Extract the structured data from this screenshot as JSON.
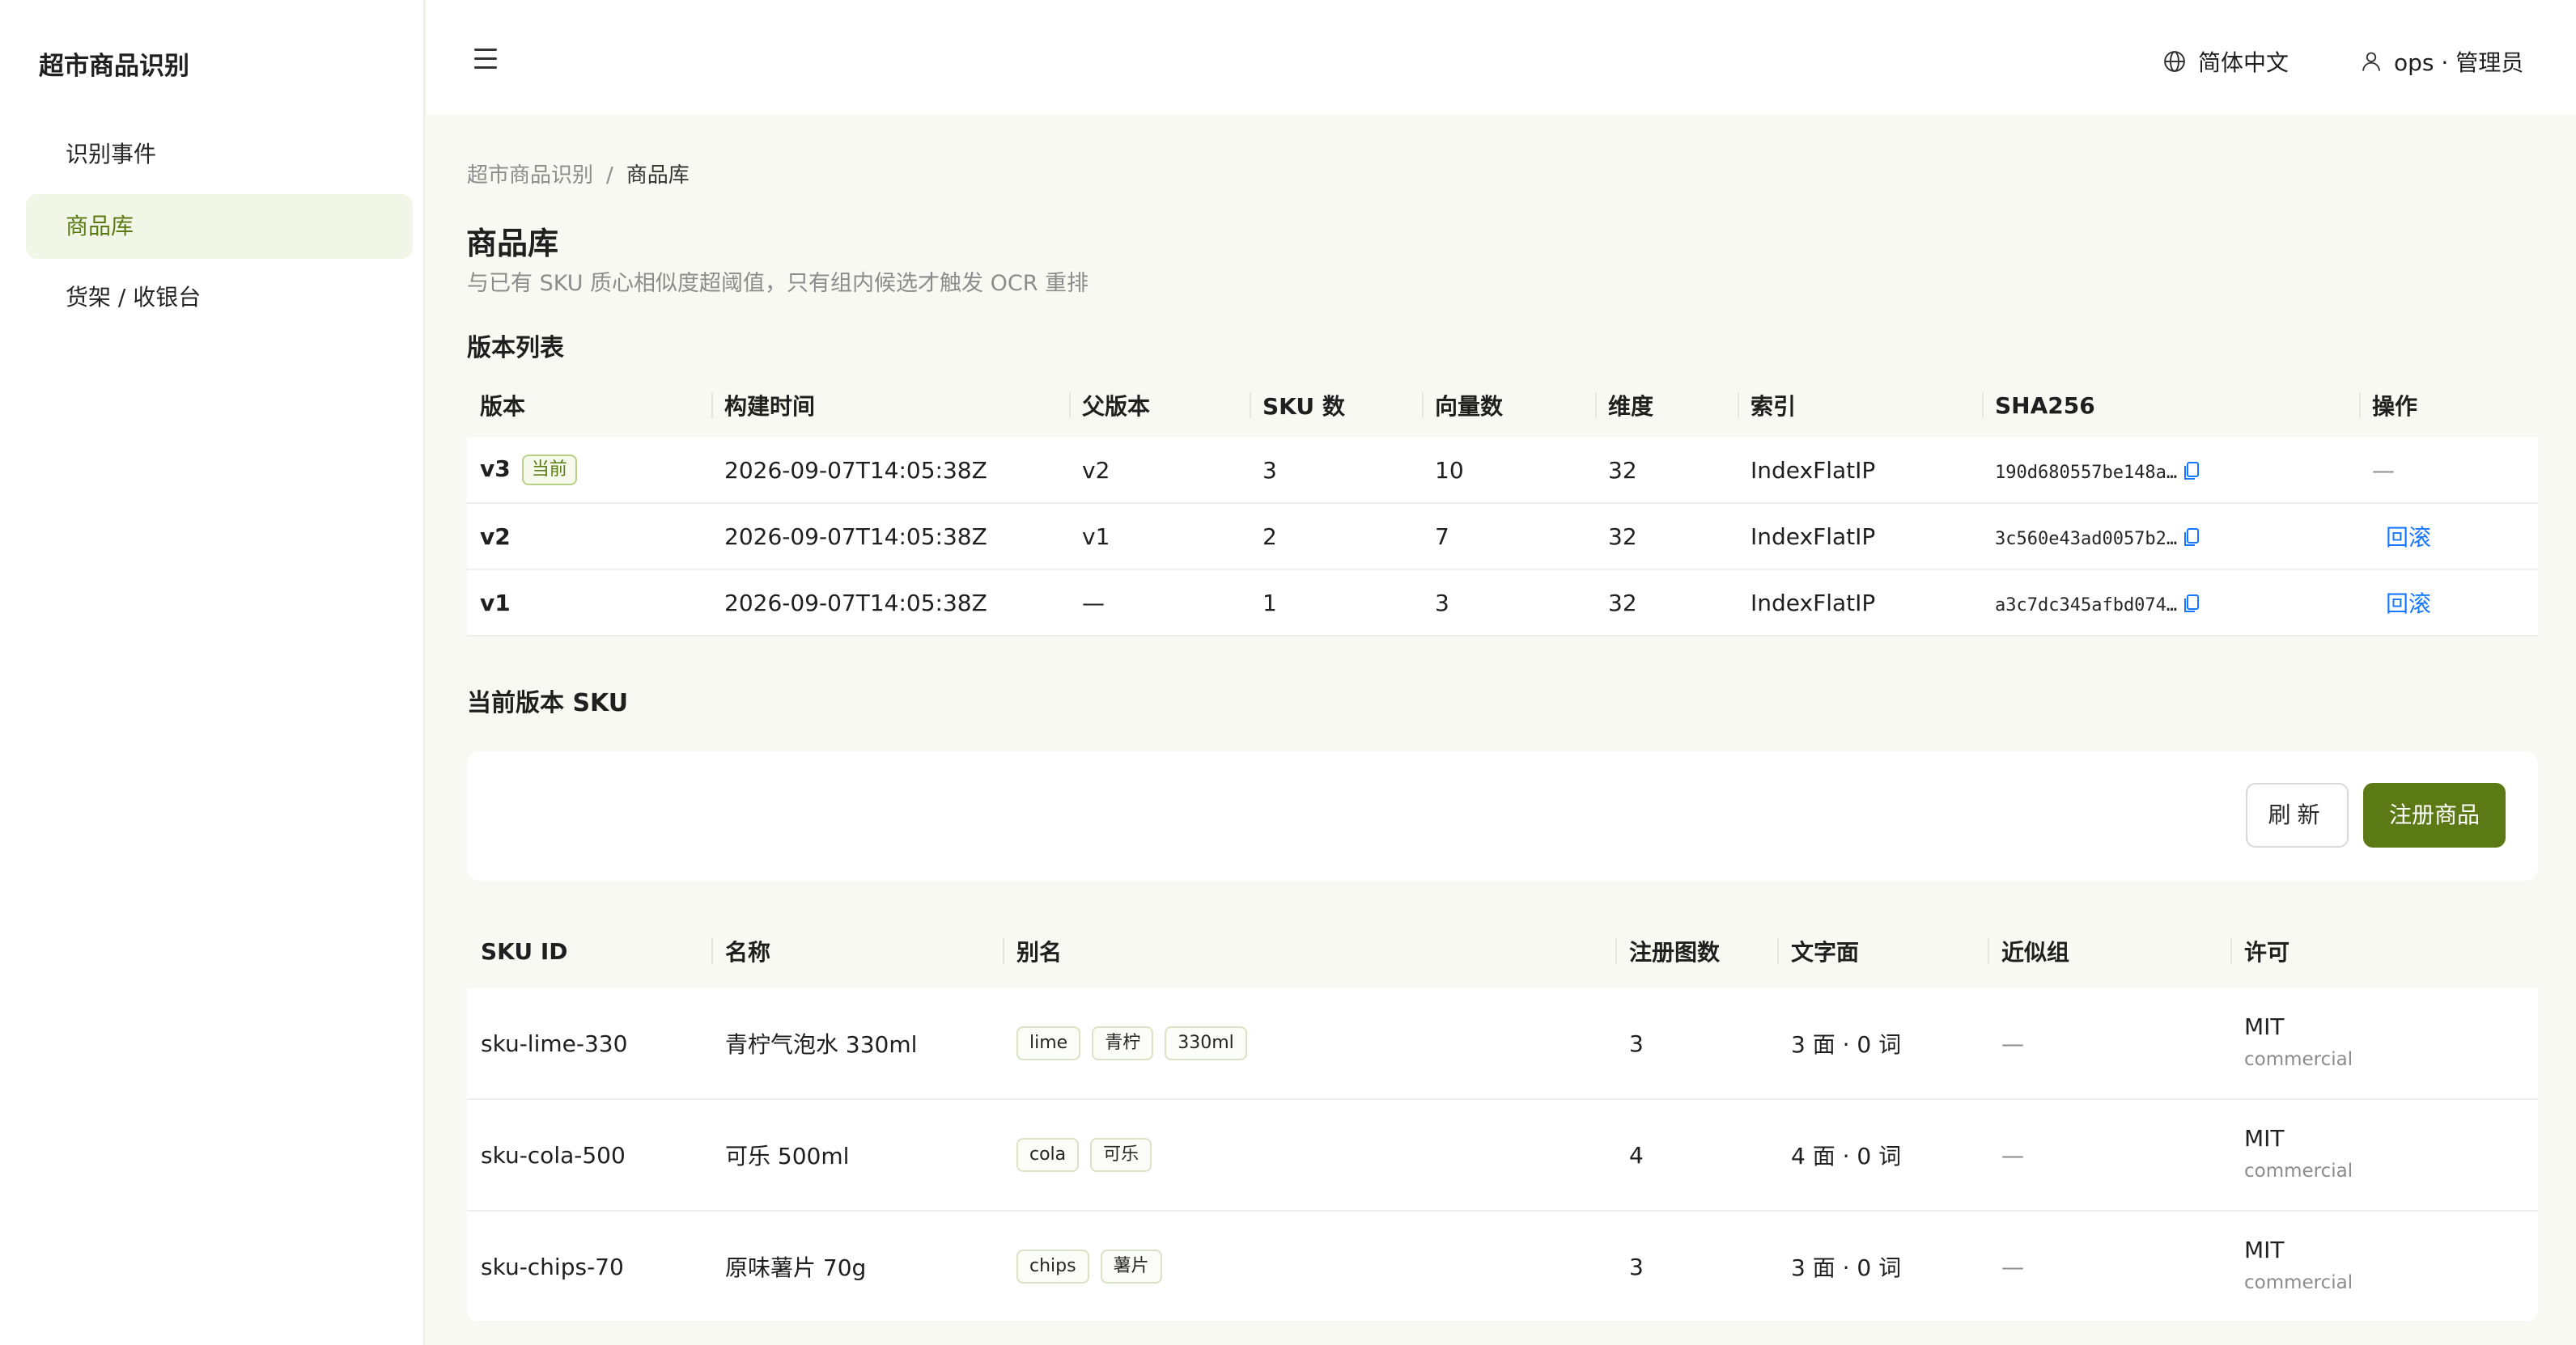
{
  "app": {
    "title": "超市商品识别"
  },
  "sidebar": {
    "items": [
      {
        "label": "识别事件",
        "active": false
      },
      {
        "label": "商品库",
        "active": true
      },
      {
        "label": "货架 / 收银台",
        "active": false
      }
    ]
  },
  "header": {
    "language": "简体中文",
    "user": "ops · 管理员"
  },
  "breadcrumb": {
    "root": "超市商品识别",
    "separator": "/",
    "current": "商品库"
  },
  "page": {
    "title": "商品库",
    "description": "与已有 SKU 质心相似度超阈值，只有组内候选才触发 OCR 重排"
  },
  "versions": {
    "section_title": "版本列表",
    "columns": [
      "版本",
      "构建时间",
      "父版本",
      "SKU 数",
      "向量数",
      "维度",
      "索引",
      "SHA256",
      "操作"
    ],
    "current_tag": "当前",
    "rows": [
      {
        "version": "v3",
        "built_at": "2026-09-07T14:05:38Z",
        "parent": "v2",
        "sku_count": "3",
        "vector_count": "10",
        "dim": "32",
        "index": "IndexFlatIP",
        "sha": "190d680557be148a…",
        "action": "—",
        "current": true
      },
      {
        "version": "v2",
        "built_at": "2026-09-07T14:05:38Z",
        "parent": "v1",
        "sku_count": "2",
        "vector_count": "7",
        "dim": "32",
        "index": "IndexFlatIP",
        "sha": "3c560e43ad0057b2…",
        "action": "回滚",
        "current": false
      },
      {
        "version": "v1",
        "built_at": "2026-09-07T14:05:38Z",
        "parent": "—",
        "sku_count": "1",
        "vector_count": "3",
        "dim": "32",
        "index": "IndexFlatIP",
        "sha": "a3c7dc345afbd074…",
        "action": "回滚",
        "current": false
      }
    ]
  },
  "skus": {
    "section_title": "当前版本 SKU",
    "refresh_label": "刷新",
    "register_label": "注册商品",
    "columns": [
      "SKU ID",
      "名称",
      "别名",
      "注册图数",
      "文字面",
      "近似组",
      "许可"
    ],
    "rows": [
      {
        "id": "sku-lime-330",
        "name": "青柠气泡水 330ml",
        "aliases": [
          "lime",
          "青柠",
          "330ml"
        ],
        "images": "3",
        "text_faces": "3 面 · 0 词",
        "group": "—",
        "license": "MIT",
        "license_sub": "commercial"
      },
      {
        "id": "sku-cola-500",
        "name": "可乐 500ml",
        "aliases": [
          "cola",
          "可乐"
        ],
        "images": "4",
        "text_faces": "4 面 · 0 词",
        "group": "—",
        "license": "MIT",
        "license_sub": "commercial"
      },
      {
        "id": "sku-chips-70",
        "name": "原味薯片 70g",
        "aliases": [
          "chips",
          "薯片"
        ],
        "images": "3",
        "text_faces": "3 面 · 0 词",
        "group": "—",
        "license": "MIT",
        "license_sub": "commercial"
      }
    ]
  },
  "colors": {
    "accent": "#5b7a16",
    "link": "#1677ff",
    "background": "#f7f9f2"
  }
}
